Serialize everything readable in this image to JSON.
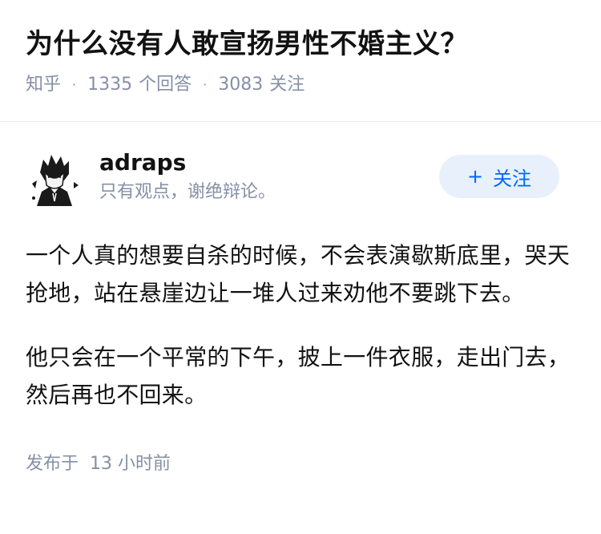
{
  "question": {
    "title": "为什么没有人敢宣扬男性不婚主义？",
    "site": "知乎",
    "answers_count": "1335",
    "answers_label": "个回答",
    "followers_count": "3083",
    "followers_label": "关注"
  },
  "answer": {
    "author_name": "adraps",
    "author_bio": "只有观点，谢绝辩论。",
    "follow_label": "关注",
    "paragraphs": [
      "一个人真的想要自杀的时候，不会表演歇斯底里，哭天抢地，站在悬崖边让一堆人过来劝他不要跳下去。",
      "他只会在一个平常的下午，披上一件衣服，走出门去，然后再也不回来。"
    ],
    "posted_label": "发布于",
    "posted_time": "13 小时前"
  },
  "colors": {
    "accent": "#0066ff",
    "follow_bg": "#e8f1fb",
    "meta": "#8590a6",
    "text": "#121212"
  },
  "icons": {
    "follow": "plus-icon",
    "avatar": "anime-avatar"
  }
}
